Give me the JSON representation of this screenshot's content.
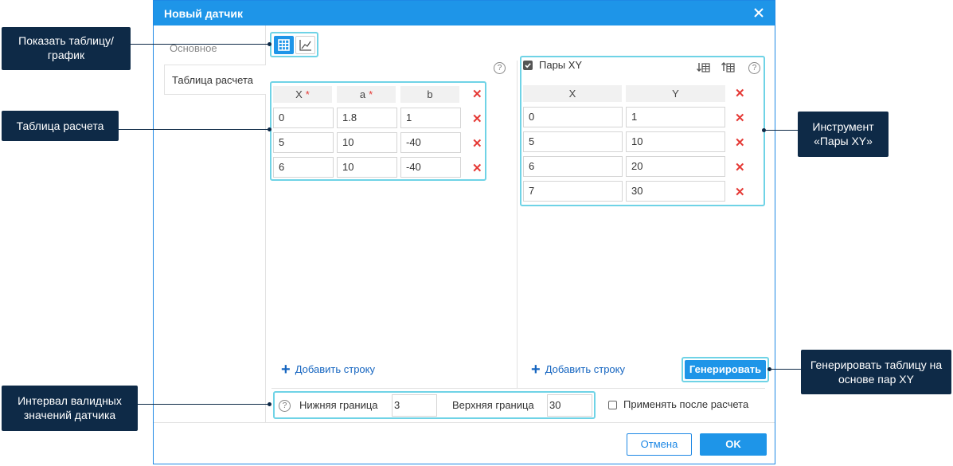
{
  "dialog": {
    "title": "Новый датчик",
    "close_icon": "close-icon"
  },
  "tabs": {
    "basic": "Основное",
    "calc_table": "Таблица расчета"
  },
  "view_toggle": {
    "table_icon": "table-icon",
    "chart_icon": "chart-icon"
  },
  "calc_table": {
    "columns": [
      "X",
      "a",
      "b"
    ],
    "rows": [
      [
        "0",
        "1.8",
        "1"
      ],
      [
        "5",
        "10",
        "-40"
      ],
      [
        "6",
        "10",
        "-40"
      ]
    ],
    "add_row": "Добавить строку"
  },
  "xy_pairs": {
    "label": "Пары XY",
    "checked": true,
    "columns": [
      "X",
      "Y"
    ],
    "rows": [
      [
        "0",
        "1"
      ],
      [
        "5",
        "10"
      ],
      [
        "6",
        "20"
      ],
      [
        "7",
        "30"
      ]
    ],
    "add_row": "Добавить строку",
    "generate": "Генерировать"
  },
  "bounds": {
    "lower_label": "Нижняя граница",
    "lower_value": "3",
    "upper_label": "Верхняя граница",
    "upper_value": "30",
    "apply_after": "Применять после расчета"
  },
  "buttons": {
    "cancel": "Отмена",
    "ok": "OK"
  },
  "callouts": {
    "show_table": "Показать таблицу/ график",
    "calc_table": "Таблица расчета",
    "xy_tool": "Инструмент «Пары XY»",
    "generate": "Генерировать таблицу на основе пар XY",
    "interval": "Интервал валидных значений датчика"
  },
  "colors": {
    "accent": "#1e95e8",
    "highlight": "#6fd3e6",
    "callout_bg": "#0e2a47",
    "delete": "#e53935"
  }
}
